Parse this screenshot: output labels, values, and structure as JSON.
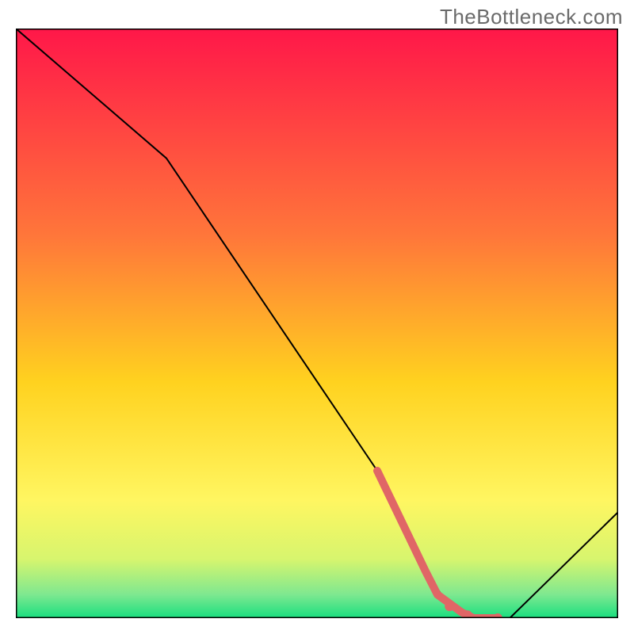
{
  "watermark": "TheBottleneck.com",
  "chart_data": {
    "type": "line",
    "title": "",
    "xlabel": "",
    "ylabel": "",
    "xlim": [
      0,
      100
    ],
    "ylim": [
      0,
      100
    ],
    "grid": false,
    "legend": false,
    "series": [
      {
        "name": "bottleneck-curve",
        "x": [
          0,
          25,
          60,
          68,
          72,
          76,
          82,
          100
        ],
        "y": [
          100,
          78,
          25,
          8,
          2,
          0,
          0,
          18
        ],
        "stroke": "#000000",
        "stroke_width": 2
      }
    ],
    "highlight_segment": {
      "name": "highlighted-range",
      "x": [
        60,
        68,
        70,
        74,
        76,
        80
      ],
      "y": [
        25,
        8,
        4,
        1,
        0,
        0
      ],
      "stroke": "#e06666",
      "stroke_width": 10,
      "dots_x": [
        72,
        75,
        80
      ],
      "dots_y": [
        2,
        0.5,
        0
      ],
      "dot_radius": 6
    },
    "background_gradient": {
      "stops": [
        {
          "offset": 0.0,
          "color": "#ff1749"
        },
        {
          "offset": 0.35,
          "color": "#ff763a"
        },
        {
          "offset": 0.6,
          "color": "#ffd21f"
        },
        {
          "offset": 0.8,
          "color": "#fff661"
        },
        {
          "offset": 0.9,
          "color": "#d7f56e"
        },
        {
          "offset": 0.96,
          "color": "#7ee890"
        },
        {
          "offset": 1.0,
          "color": "#18df7f"
        }
      ]
    },
    "frame_stroke": "#000000"
  }
}
